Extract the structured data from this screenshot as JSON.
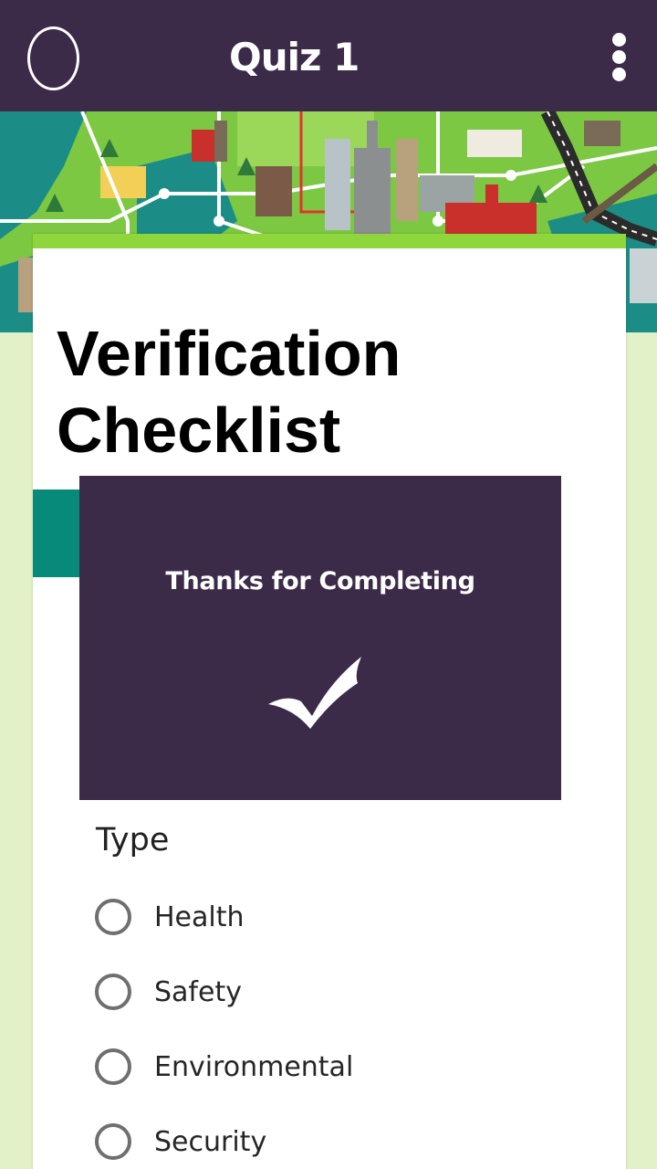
{
  "app_bar": {
    "title": "Quiz 1",
    "background": "#3b2a48",
    "left_icon": "profile-circle-icon",
    "right_icon": "more-vertical-icon"
  },
  "banner": {
    "description_icon": "city-map-illustration",
    "accent": "#8ed63b"
  },
  "form": {
    "title": "Verification Checklist",
    "accent": "#8ed63b"
  },
  "completion_dialog": {
    "message": "Thanks for Completing",
    "icon": "checkmark-icon",
    "background": "#3b2a48"
  },
  "question": {
    "label": "Type",
    "options": [
      {
        "label": "Health",
        "selected": false
      },
      {
        "label": "Safety",
        "selected": false
      },
      {
        "label": "Environmental",
        "selected": false
      },
      {
        "label": "Security",
        "selected": false
      }
    ]
  }
}
